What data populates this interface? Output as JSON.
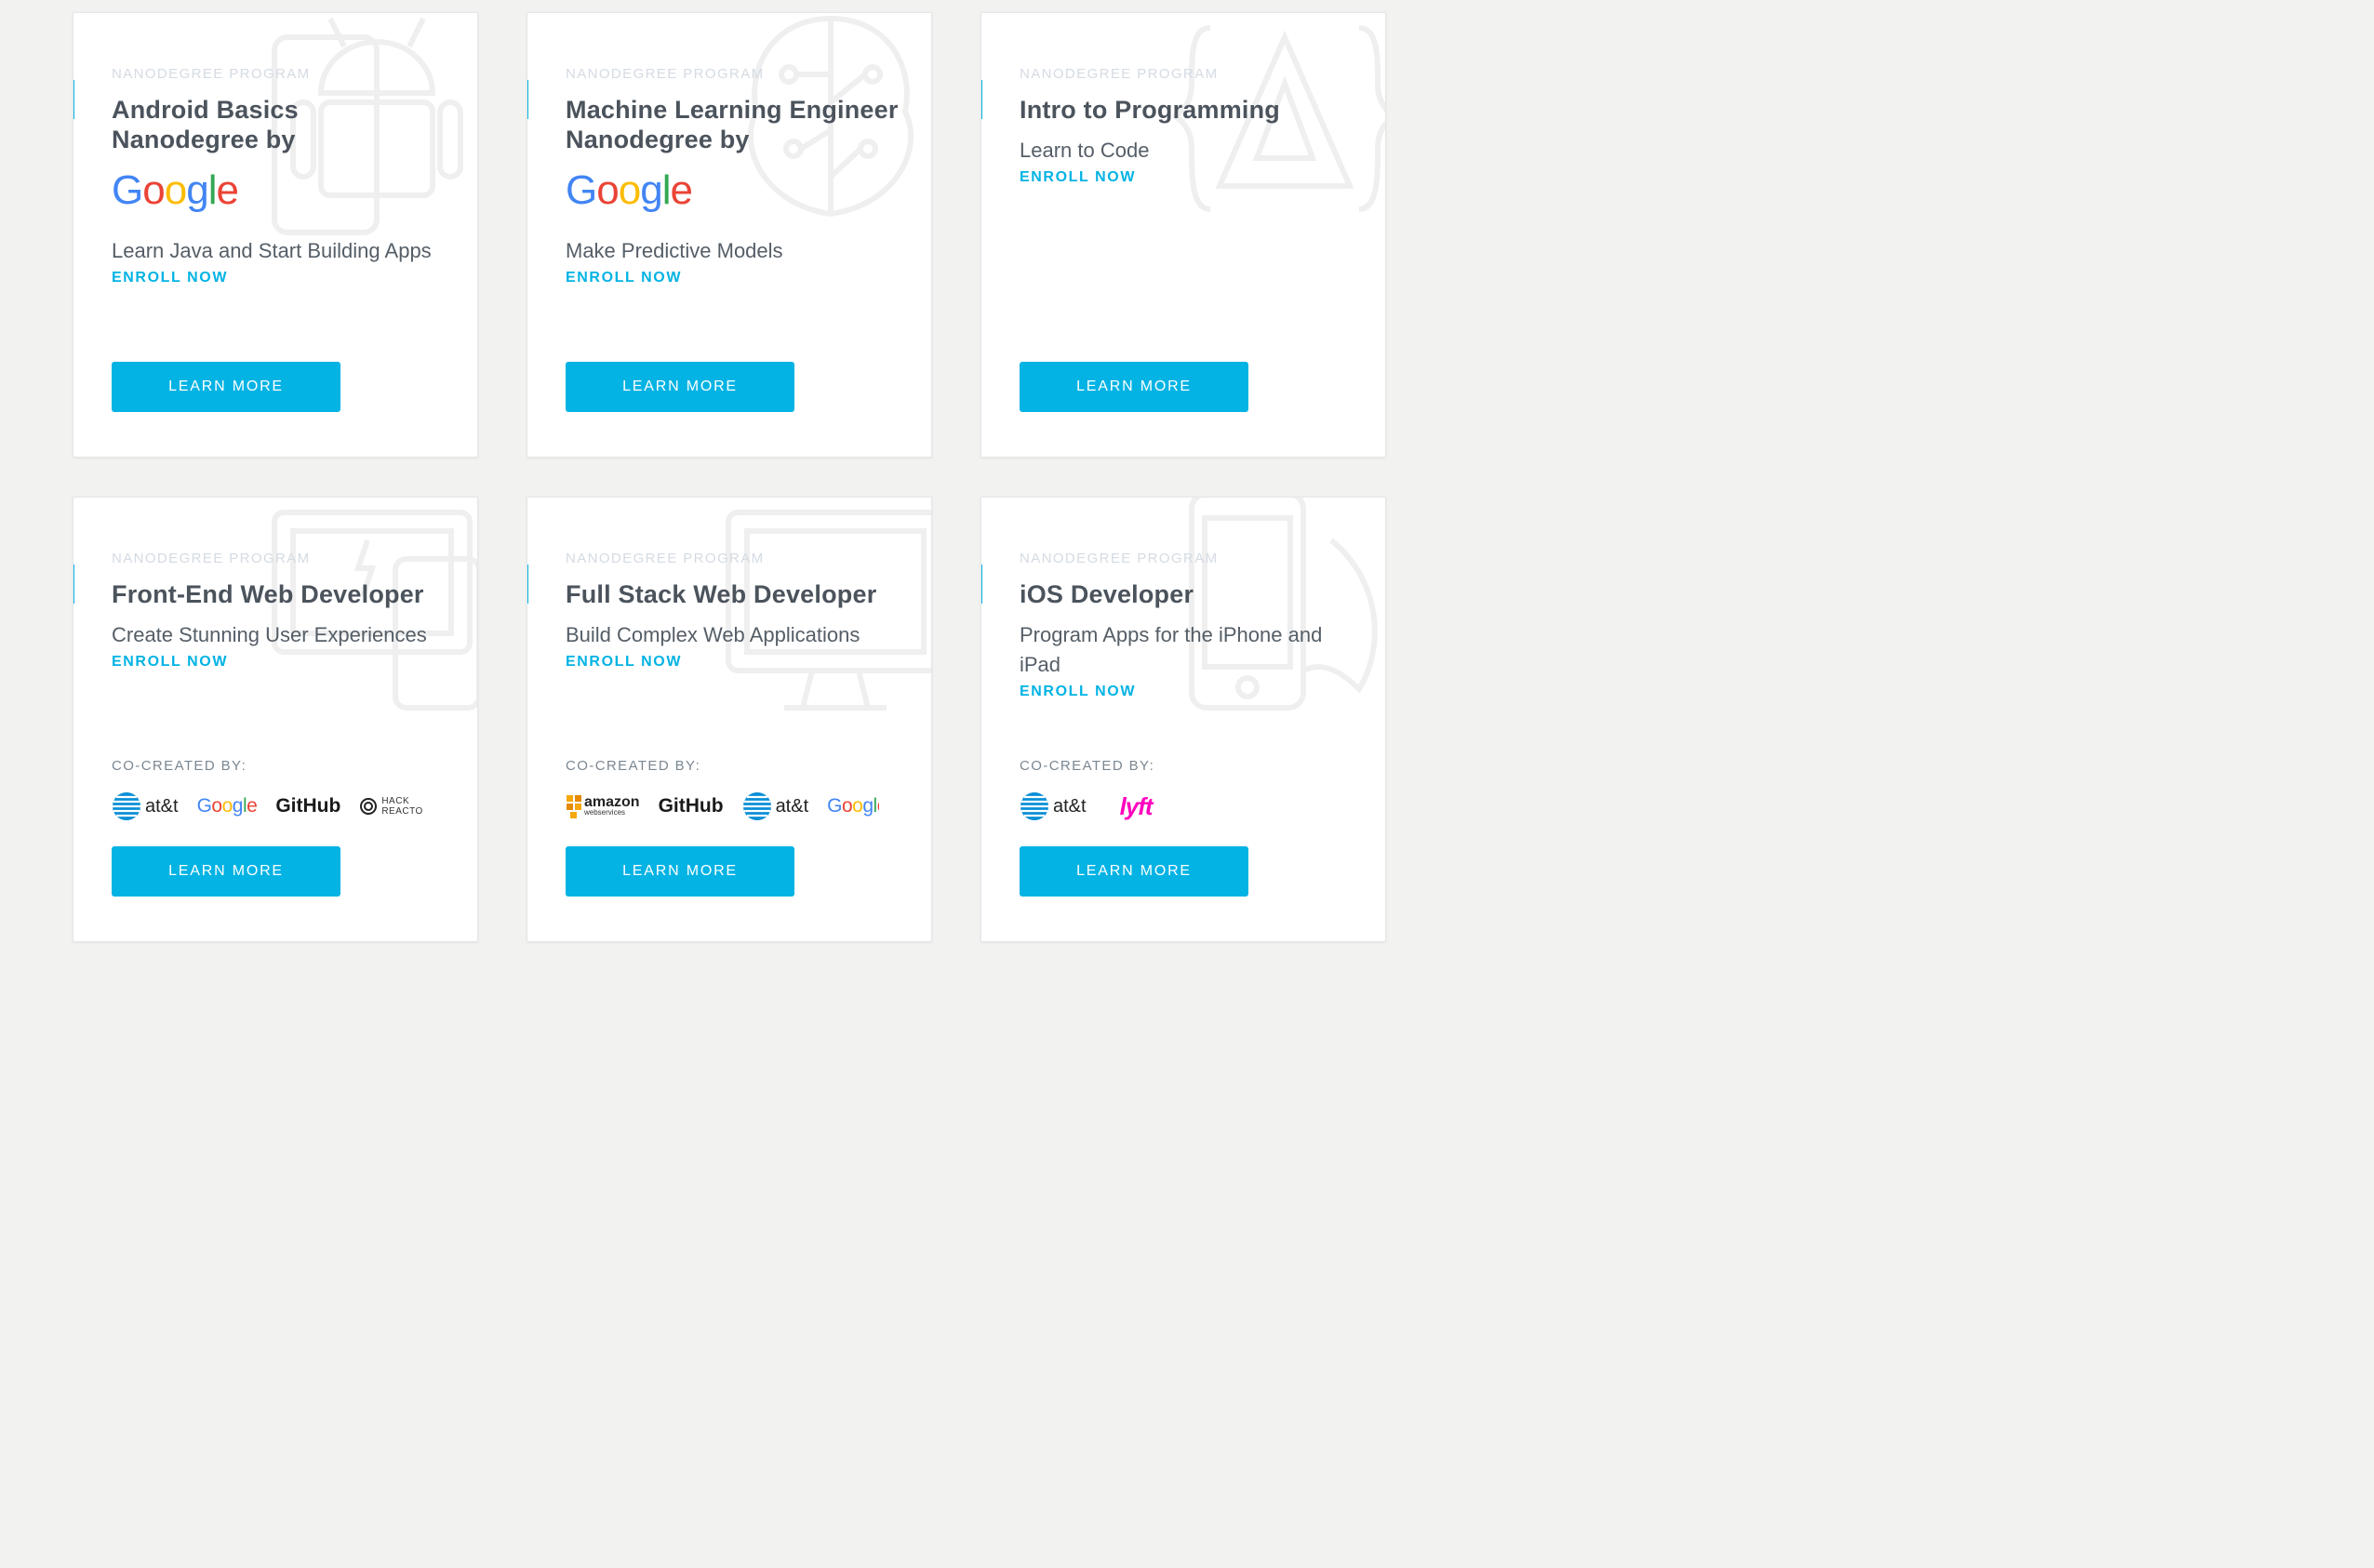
{
  "colors": {
    "accent": "#02b3e4",
    "page_background": "#f2f2f0",
    "card_background": "#ffffff",
    "title": "#4b535c",
    "eyebrow": "#d4dbe3",
    "google_blue": "#4285f4",
    "google_red": "#ea4335",
    "google_yellow": "#fbbc05",
    "google_green": "#34a853",
    "lyft_pink": "#ff00bf"
  },
  "cards": [
    {
      "eyebrow": "NANODEGREE PROGRAM",
      "title": "Android Basics Nanodegree by",
      "brand_logo": "Google",
      "subtitle": "Learn Java and Start Building Apps",
      "enroll": "ENROLL NOW",
      "button": "LEARN MORE",
      "bg_icon": "android-icon"
    },
    {
      "eyebrow": "NANODEGREE PROGRAM",
      "title": "Machine Learning Engineer Nanodegree by",
      "brand_logo": "Google",
      "subtitle": "Make Predictive Models",
      "enroll": "ENROLL NOW",
      "button": "LEARN MORE",
      "bg_icon": "brain-circuit-icon"
    },
    {
      "eyebrow": "NANODEGREE PROGRAM",
      "title": "Intro to Programming",
      "subtitle": "Learn to Code",
      "enroll": "ENROLL NOW",
      "button": "LEARN MORE",
      "bg_icon": "code-braces-triangle-icon"
    },
    {
      "eyebrow": "NANODEGREE PROGRAM",
      "title": "Front-End Web Developer",
      "subtitle": "Create Stunning User Experiences",
      "enroll": "ENROLL NOW",
      "cocreated_label": "CO-CREATED BY:",
      "partners": [
        "at&t",
        "Google",
        "GitHub",
        "HACK REACTOR"
      ],
      "button": "LEARN MORE",
      "bg_icon": "devices-icon"
    },
    {
      "eyebrow": "NANODEGREE PROGRAM",
      "title": "Full Stack Web Developer",
      "subtitle": "Build Complex Web Applications",
      "enroll": "ENROLL NOW",
      "cocreated_label": "CO-CREATED BY:",
      "partners": [
        "amazon web services",
        "GitHub",
        "at&t",
        "Google"
      ],
      "button": "LEARN MORE",
      "bg_icon": "monitor-icon"
    },
    {
      "eyebrow": "NANODEGREE PROGRAM",
      "title": "iOS Developer",
      "subtitle": "Program Apps for the iPhone and iPad",
      "enroll": "ENROLL NOW",
      "cocreated_label": "CO-CREATED BY:",
      "partners": [
        "at&t",
        "lyft"
      ],
      "button": "LEARN MORE",
      "bg_icon": "iphone-swift-icon"
    }
  ],
  "partner_text": {
    "att": "at&t",
    "google": "Google",
    "github": "GitHub",
    "hack_line1": "HACK",
    "hack_line2": "REACTO",
    "amazon_word": "amazon",
    "amazon_sub": "webservices",
    "lyft": "lyft"
  }
}
